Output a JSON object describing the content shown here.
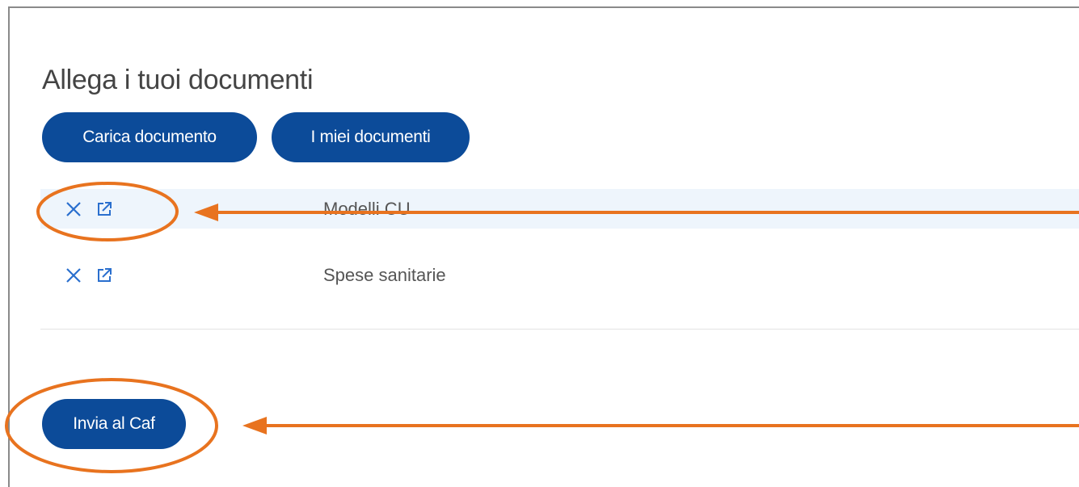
{
  "page": {
    "title": "Allega i tuoi documenti"
  },
  "toolbar": {
    "upload_label": "Carica documento",
    "my_documents_label": "I miei documenti"
  },
  "documents": [
    {
      "name": "Modelli CU",
      "remove_icon": "close-icon",
      "open_icon": "external-link-icon",
      "highlighted": true
    },
    {
      "name": "Spese sanitarie",
      "remove_icon": "close-icon",
      "open_icon": "external-link-icon",
      "highlighted": false
    }
  ],
  "footer": {
    "send_label": "Invia al Caf"
  },
  "colors": {
    "primary": "#0c4b99",
    "icon": "#2a6fce",
    "row_highlight": "#eef5fc",
    "annotation": "#e8731f"
  }
}
